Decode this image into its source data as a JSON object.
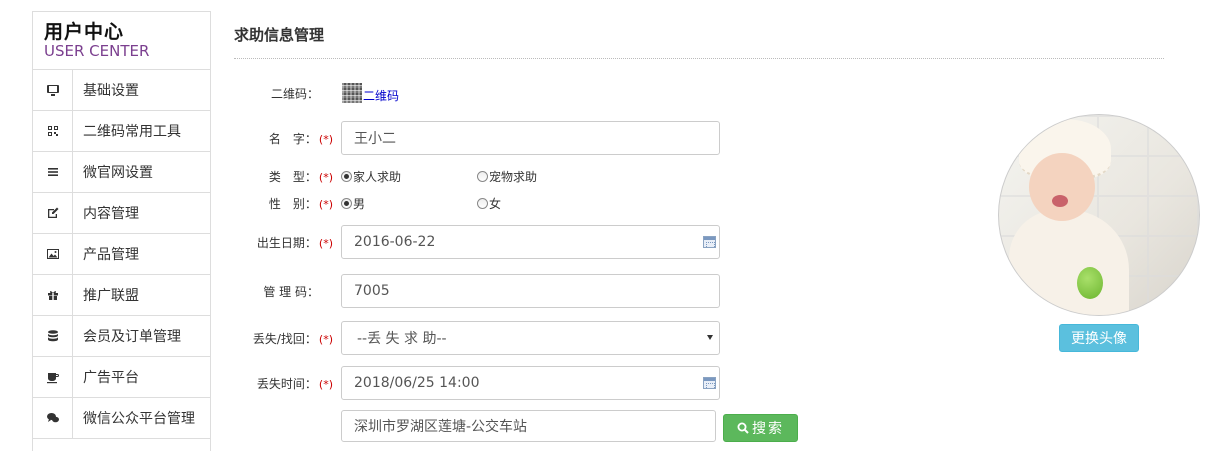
{
  "sidebar": {
    "brand_cn": "用户中心",
    "brand_en": "USER CENTER",
    "items": [
      {
        "label": "基础设置",
        "icon": "monitor-icon"
      },
      {
        "label": "二维码常用工具",
        "icon": "qrcode-icon"
      },
      {
        "label": "微官网设置",
        "icon": "list-icon"
      },
      {
        "label": "内容管理",
        "icon": "edit-icon"
      },
      {
        "label": "产品管理",
        "icon": "image-icon"
      },
      {
        "label": "推广联盟",
        "icon": "gift-icon"
      },
      {
        "label": "会员及订单管理",
        "icon": "database-icon"
      },
      {
        "label": "广告平台",
        "icon": "cup-icon"
      },
      {
        "label": "微信公众平台管理",
        "icon": "chat-icon"
      }
    ]
  },
  "main": {
    "title": "求助信息管理",
    "required_mark": "(*)",
    "qrcode": {
      "label": "二维码：",
      "link": "二维码"
    },
    "name": {
      "label": "名　字：",
      "value": "王小二"
    },
    "type": {
      "label": "类　型：",
      "options": [
        "家人求助",
        "宠物求助"
      ],
      "selected": "家人求助"
    },
    "gender": {
      "label": "性　别：",
      "options": [
        "男",
        "女"
      ],
      "selected": "男"
    },
    "birthday": {
      "label": "出生日期：",
      "value": "2016-06-22"
    },
    "manage_code": {
      "label": "管 理 码：",
      "value": "7005"
    },
    "lost_found": {
      "label": "丢失/找回：",
      "value": "--丢 失 求 助--"
    },
    "lost_time": {
      "label": "丢失时间：",
      "value": "2018/06/25 14:00"
    },
    "address": {
      "value": "深圳市罗湖区莲塘-公交车站"
    },
    "search_button": "搜索"
  },
  "avatar": {
    "change_button": "更换头像"
  }
}
